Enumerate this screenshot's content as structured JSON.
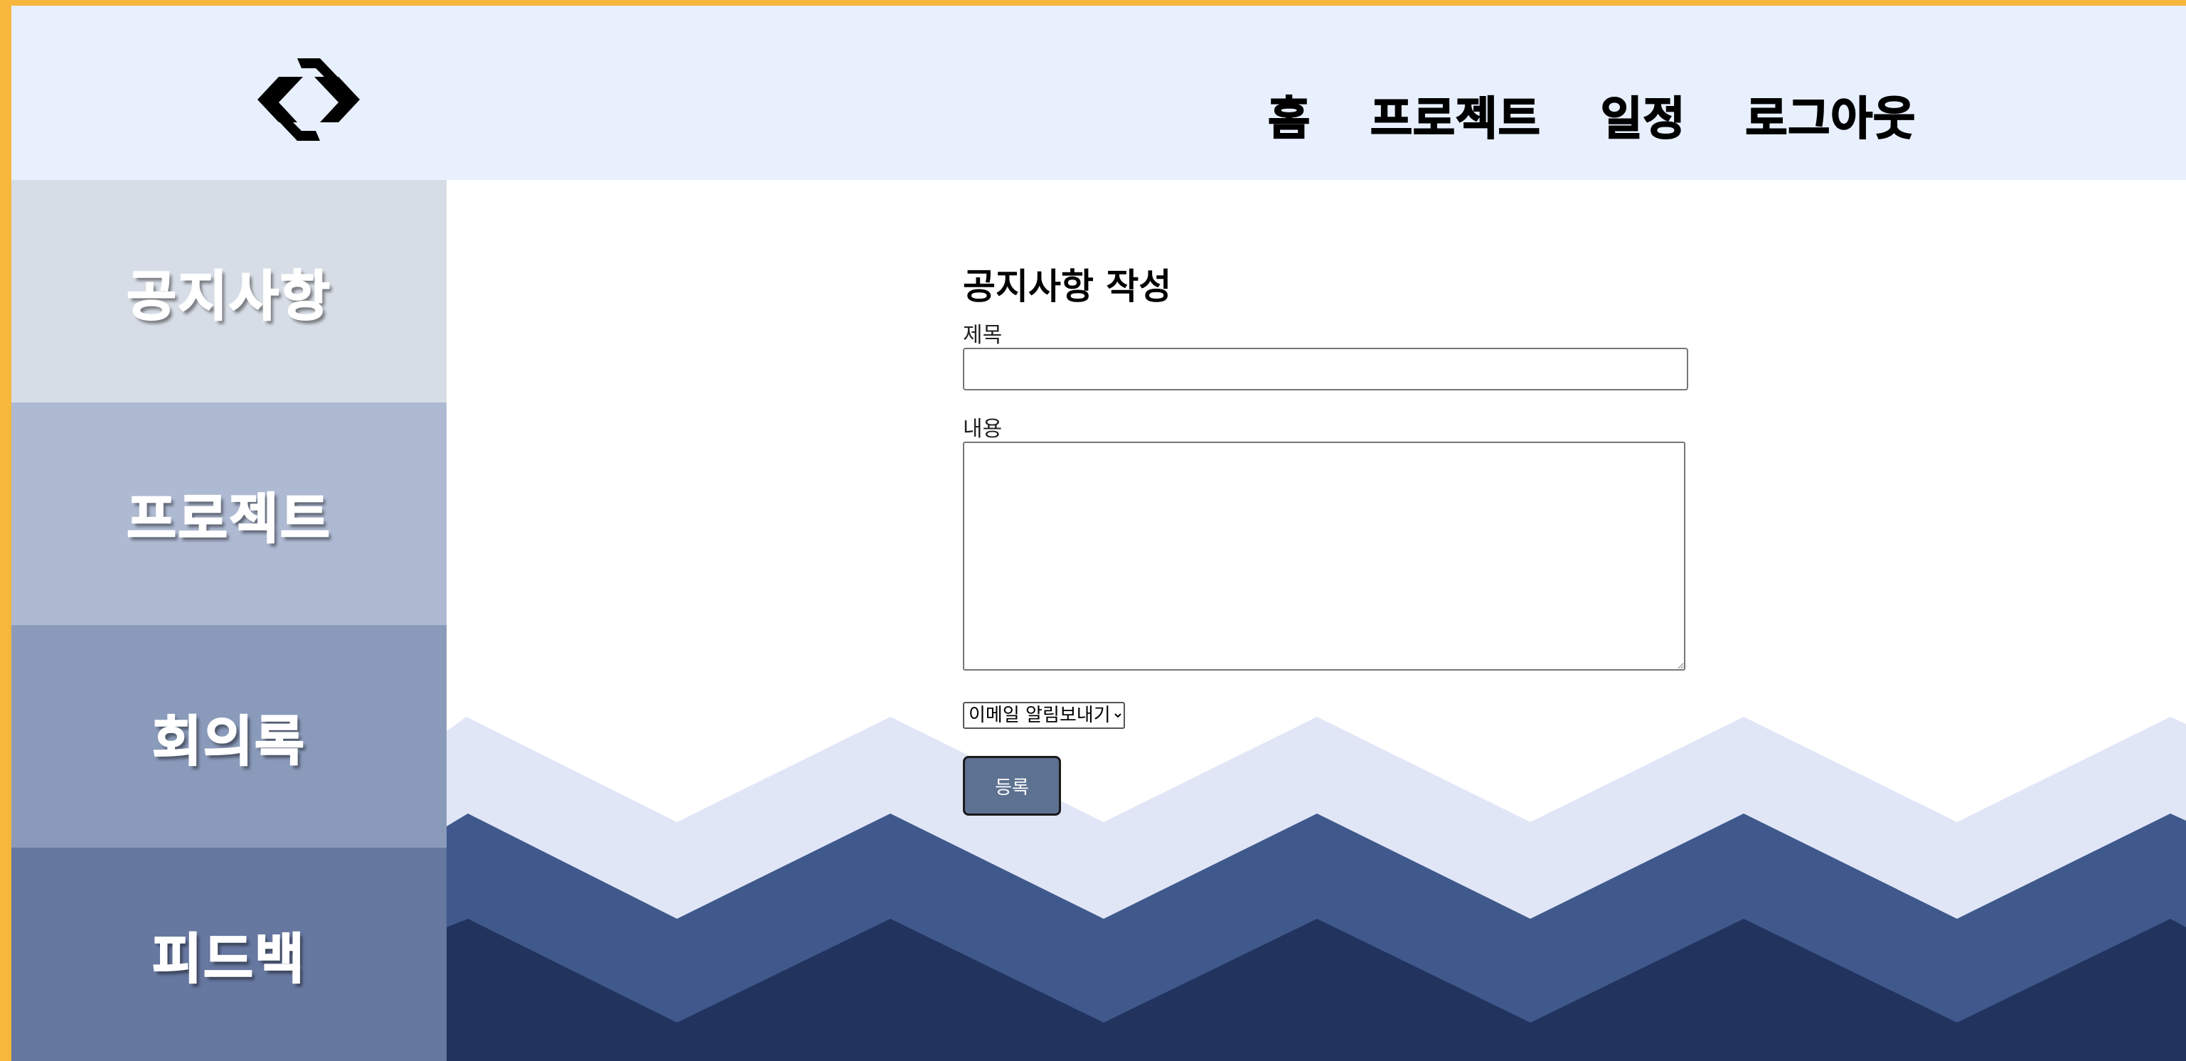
{
  "header": {
    "logo_icon": "diamond-link-logo-icon",
    "nav": [
      "홈",
      "프로젝트",
      "일정",
      "로그아웃"
    ]
  },
  "sidebar": {
    "items": [
      {
        "label": "공지사항",
        "color": "#d7dde6"
      },
      {
        "label": "프로젝트",
        "color": "#aeb9d2"
      },
      {
        "label": "회의록",
        "color": "#8a9aba"
      },
      {
        "label": "피드백",
        "color": "#6677a0"
      }
    ]
  },
  "form": {
    "title": "공지사항 작성",
    "title_label": "제목",
    "title_value": "",
    "content_label": "내용",
    "content_value": "",
    "email_option": "이메일 알림보내기",
    "submit_label": "등록"
  },
  "colors": {
    "frame_border": "#f6b73c",
    "header_bg": "#e8f0fe",
    "wave_light": "#e1e6f7",
    "wave_mid": "#3f598c",
    "wave_dark": "#22335e",
    "button_bg": "#5d7190"
  }
}
